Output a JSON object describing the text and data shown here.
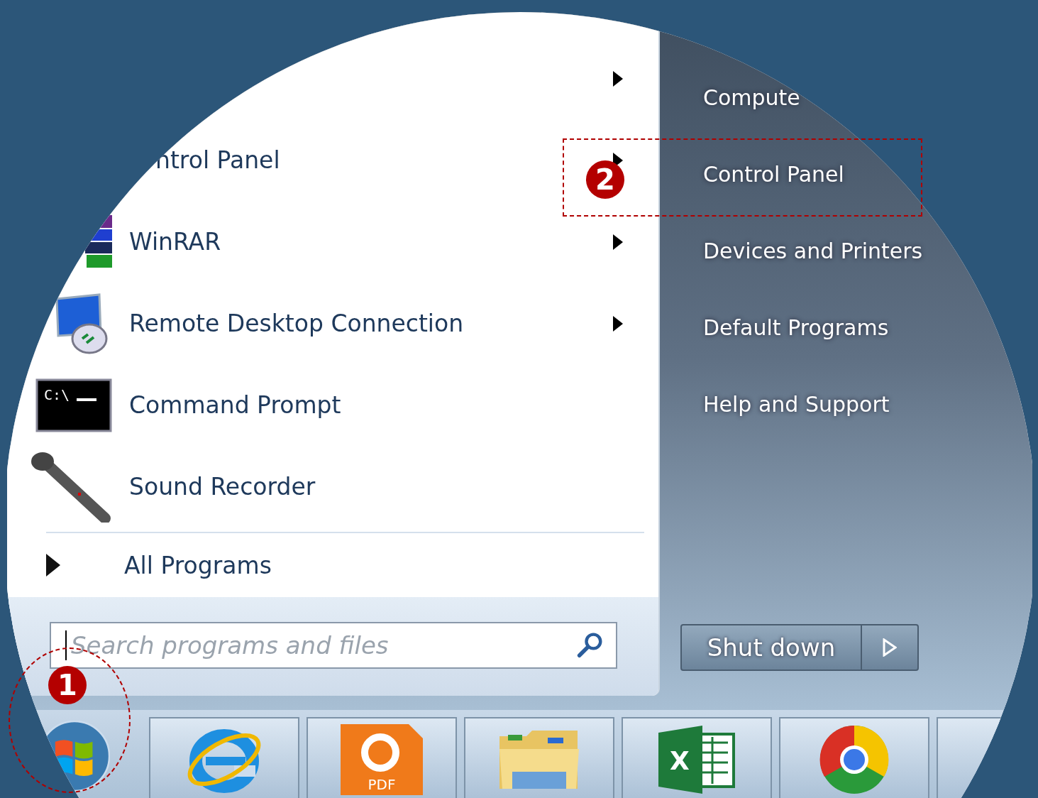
{
  "start_menu": {
    "programs": [
      {
        "has_submenu": true
      },
      {
        "label": "ntrol Panel",
        "has_submenu": true
      },
      {
        "label": "WinRAR",
        "kind": "archiver",
        "has_submenu": true
      },
      {
        "label": "Remote Desktop Connection",
        "kind": "remote",
        "has_submenu": true
      },
      {
        "label": "Command Prompt",
        "kind": "console",
        "icon_text": "C:\\",
        "has_submenu": false
      },
      {
        "label": "Sound Recorder",
        "kind": "recorder",
        "has_submenu": false
      }
    ],
    "all_programs": {
      "label": "All Programs"
    },
    "search": {
      "placeholder": "Search programs and files"
    },
    "right_items": [
      {
        "label": "Compute"
      },
      {
        "label": "Control Panel"
      },
      {
        "label": "Devices and Printers"
      },
      {
        "label": "Default Programs"
      },
      {
        "label": "Help and Support"
      }
    ],
    "shutdown": {
      "label": "Shut down"
    }
  },
  "taskbar": [
    {
      "kind": "start"
    },
    {
      "kind": "browser"
    },
    {
      "kind": "pdf",
      "label": "PDF"
    },
    {
      "kind": "folder"
    },
    {
      "kind": "spreadsheet",
      "label": "X"
    },
    {
      "kind": "globe"
    },
    {
      "kind": "app"
    }
  ],
  "callouts": [
    {
      "number": "1",
      "kind": "circle"
    },
    {
      "number": "2",
      "kind": "rect"
    }
  ]
}
